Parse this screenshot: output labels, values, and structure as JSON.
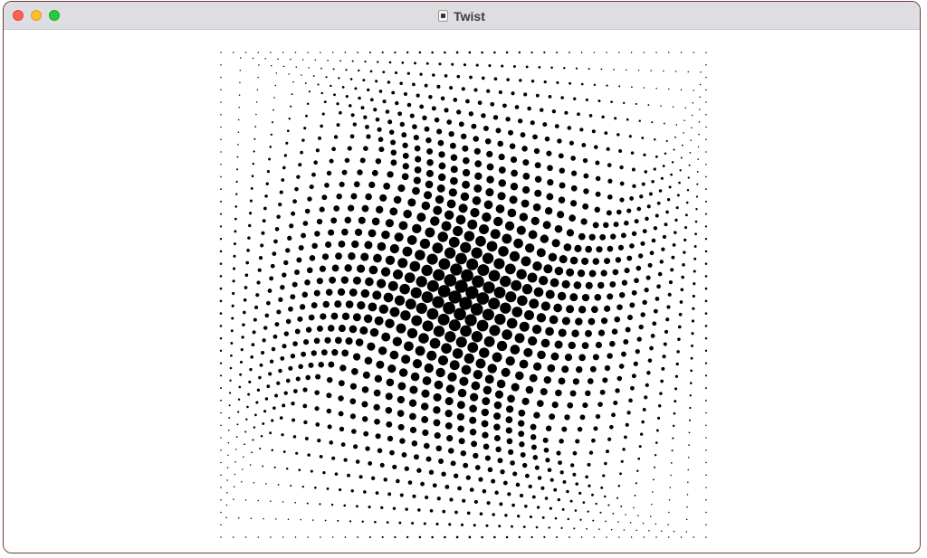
{
  "window": {
    "title": "Twist"
  },
  "canvas": {
    "dot_color": "#000000",
    "background": "#ffffff",
    "grid_columns": 40,
    "grid_rows": 40
  }
}
